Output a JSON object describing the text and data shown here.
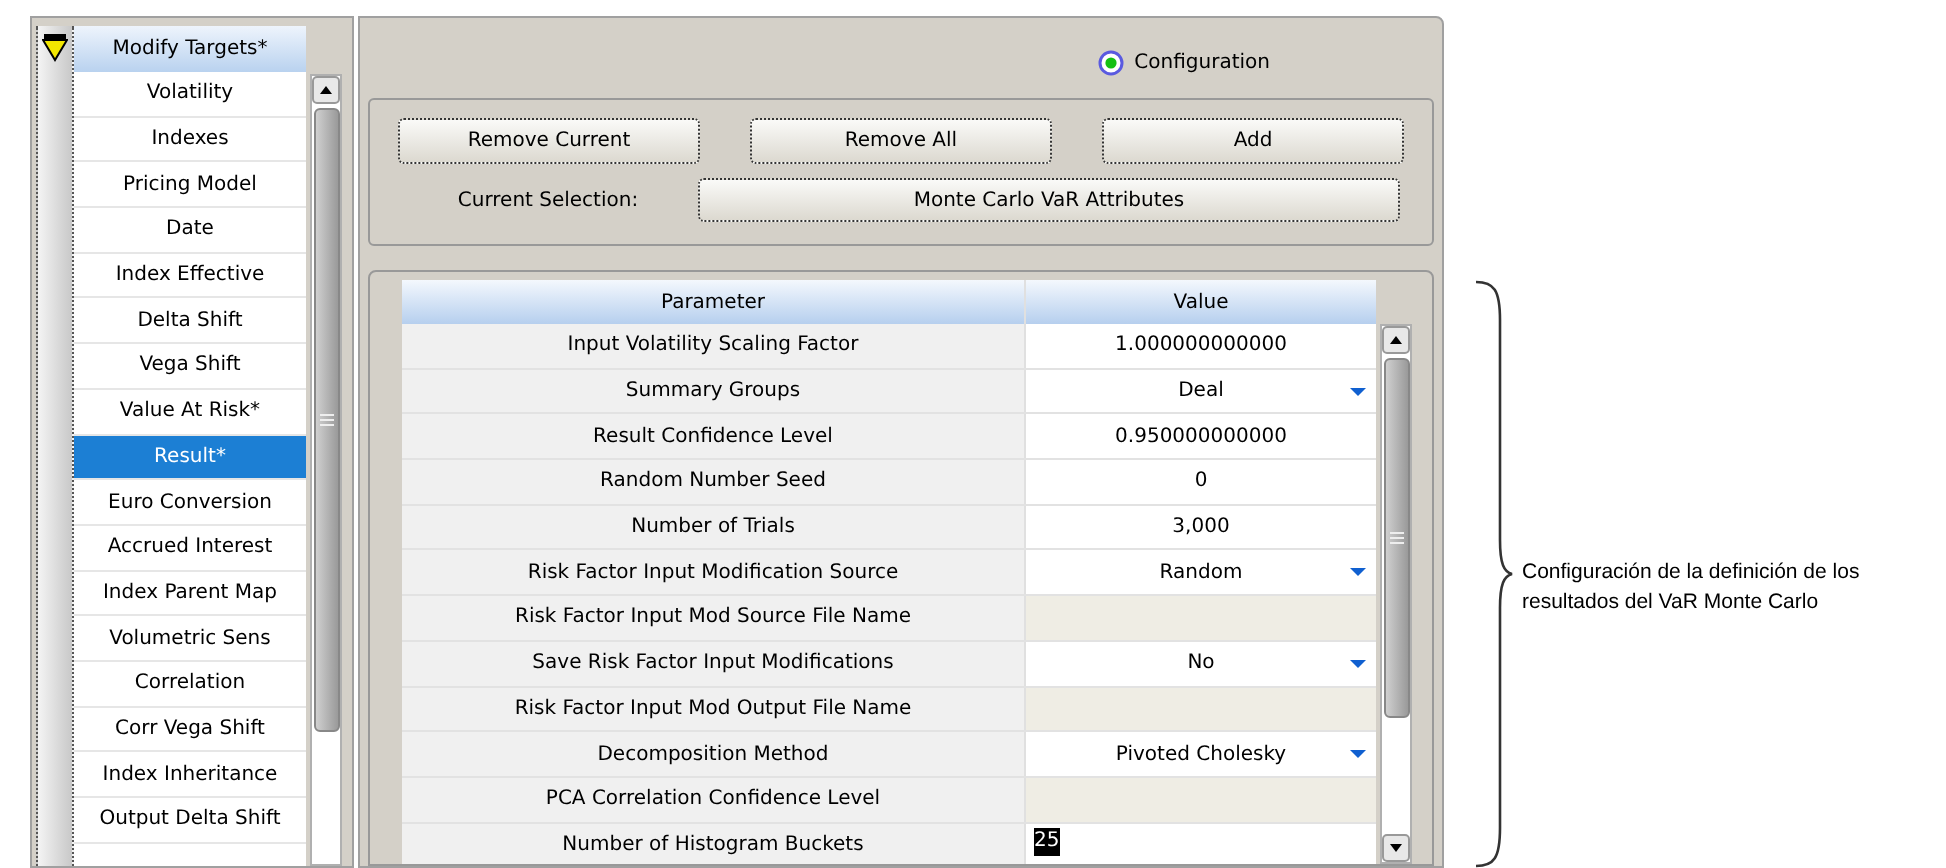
{
  "targets": {
    "header": "Modify Targets*",
    "items": [
      {
        "label": "Volatility",
        "selected": false
      },
      {
        "label": "Indexes",
        "selected": false
      },
      {
        "label": "Pricing Model",
        "selected": false
      },
      {
        "label": "Date",
        "selected": false
      },
      {
        "label": "Index Effective",
        "selected": false
      },
      {
        "label": "Delta Shift",
        "selected": false
      },
      {
        "label": "Vega Shift",
        "selected": false
      },
      {
        "label": "Value At Risk*",
        "selected": false
      },
      {
        "label": "Result*",
        "selected": true
      },
      {
        "label": "Euro Conversion",
        "selected": false
      },
      {
        "label": "Accrued Interest",
        "selected": false
      },
      {
        "label": "Index Parent Map",
        "selected": false
      },
      {
        "label": "Volumetric Sens",
        "selected": false
      },
      {
        "label": "Correlation",
        "selected": false
      },
      {
        "label": "Corr Vega Shift",
        "selected": false
      },
      {
        "label": "Index Inheritance",
        "selected": false
      },
      {
        "label": "Output Delta Shift",
        "selected": false
      }
    ]
  },
  "mode": {
    "label": "Configuration",
    "selected": true
  },
  "actions": [
    "Remove Current",
    "Remove All",
    "Add"
  ],
  "current_selection": {
    "label": "Current Selection:",
    "value": "Monte Carlo VaR Attributes"
  },
  "table": {
    "columns": [
      "Parameter",
      "Value"
    ],
    "rows": [
      {
        "parameter": "Input Volatility Scaling Factor",
        "kind": "text",
        "value": "1.000000000000"
      },
      {
        "parameter": "Summary Groups",
        "kind": "dropdown",
        "value": "Deal"
      },
      {
        "parameter": "Result Confidence Level",
        "kind": "text",
        "value": "0.950000000000"
      },
      {
        "parameter": "Random Number Seed",
        "kind": "text",
        "value": "0"
      },
      {
        "parameter": "Number of Trials",
        "kind": "text",
        "value": "3,000"
      },
      {
        "parameter": "Risk Factor Input Modification Source",
        "kind": "dropdown",
        "value": "Random"
      },
      {
        "parameter": "Risk Factor Input Mod Source File Name",
        "kind": "disabled"
      },
      {
        "parameter": "Save Risk Factor Input Modifications",
        "kind": "dropdown",
        "value": "No"
      },
      {
        "parameter": "Risk Factor Input Mod Output File Name",
        "kind": "disabled"
      },
      {
        "parameter": "Decomposition Method",
        "kind": "dropdown",
        "value": "Pivoted Cholesky"
      },
      {
        "parameter": "PCA Correlation Confidence Level",
        "kind": "disabled"
      },
      {
        "parameter": "Number of Histogram Buckets",
        "kind": "editing",
        "value": "25"
      }
    ]
  },
  "annotation": "Configuración de la definición de los resultados del VaR Monte Carlo"
}
